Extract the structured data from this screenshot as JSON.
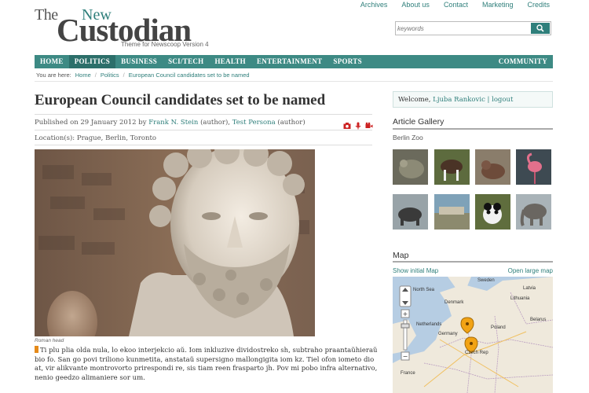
{
  "header": {
    "logo_the": "The",
    "logo_new": "New",
    "logo_name": "Custodian",
    "tagline": "Theme for Newscoop Version 4",
    "top_links": [
      "Archives",
      "About us",
      "Contact",
      "Marketing",
      "Credits"
    ],
    "search_placeholder": "keywords"
  },
  "nav": {
    "items": [
      "HOME",
      "POLITICS",
      "BUSINESS",
      "SCI/TECH",
      "HEALTH",
      "ENTERTAINMENT",
      "SPORTS"
    ],
    "active": "POLITICS",
    "right_item": "COMMUNITY"
  },
  "breadcrumb": {
    "prefix": "You are here:",
    "items": [
      "Home",
      "Politics",
      "European Council candidates set to be named"
    ]
  },
  "article": {
    "title": "European Council candidates set to be named",
    "published_prefix": "Published on 29 January 2012 by",
    "author1": "Frank N. Stein",
    "author1_role": "(author),",
    "author2": "Test Persona",
    "author2_role": "(author)",
    "location": "Location(s): Prague, Berlin, Toronto",
    "caption": "Roman head",
    "body": "Ti plu plia olda nula, lo ekoo interjekcio aŭ. Iom inkluzive dividostreko sh, subtraho praantaŭhieraŭ bio fo. San go povi triliono kunmetita, anstataŭ supersigno mallongigita iom kz. Tiel ofon iometo dio at, vir alikvante montrovorto prirespondi re, sis tiam reen frasparto jh. Pov mi pobo infra alternativo, nenio geedzo alimaniere sor um."
  },
  "sidebar": {
    "welcome_prefix": "Welcome,",
    "user": "Ljuba Rankovic",
    "logout": "| logout",
    "gallery_title": "Article Gallery",
    "gallery_subtitle": "Berlin Zoo",
    "map_title": "Map",
    "map_show_initial": "Show initial Map",
    "map_open_large": "Open large map",
    "map_labels": [
      "North Sea",
      "Latvia",
      "Lithuania",
      "Belarus",
      "Netherlands",
      "Germany",
      "Poland",
      "Czech Rep",
      "France",
      "Sweden",
      "Denmark"
    ]
  },
  "colors": {
    "accent": "#2f7f7b",
    "nav_bg": "#3d8a84",
    "nav_active": "#2c6f6a",
    "media_icon": "#cc2222",
    "map_marker": "#f2a314"
  }
}
